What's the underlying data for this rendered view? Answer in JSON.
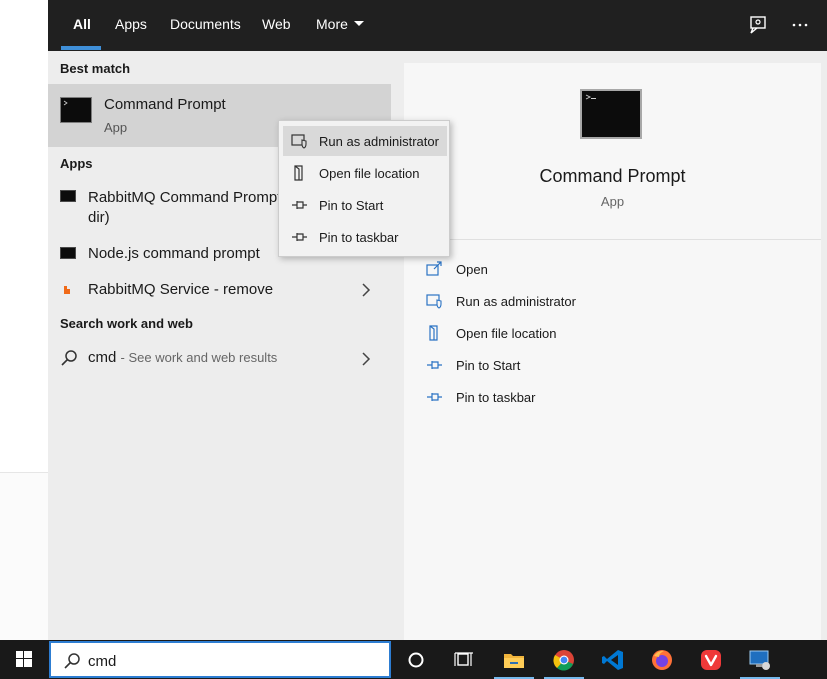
{
  "tabs": [
    {
      "label": "All"
    },
    {
      "label": "Apps"
    },
    {
      "label": "Documents"
    },
    {
      "label": "Web"
    },
    {
      "label": "More"
    }
  ],
  "left": {
    "best_match_heading": "Best match",
    "best_match": {
      "title": "Command Prompt",
      "subtitle": "App"
    },
    "apps_heading": "Apps",
    "apps": [
      {
        "line1": "RabbitMQ Command Prompt",
        "line2": "dir)"
      },
      {
        "label": "Node.js command prompt"
      },
      {
        "label": "RabbitMQ Service - remove"
      }
    ],
    "web_heading": "Search work and web",
    "web_query": "cmd",
    "web_hint": "- See work and web results"
  },
  "context_menu": {
    "items": [
      {
        "label": "Run as administrator"
      },
      {
        "label": "Open file location"
      },
      {
        "label": "Pin to Start"
      },
      {
        "label": "Pin to taskbar"
      }
    ]
  },
  "preview": {
    "title": "Command Prompt",
    "subtitle": "App",
    "actions": [
      {
        "label": "Open"
      },
      {
        "label": "Run as administrator"
      },
      {
        "label": "Open file location"
      },
      {
        "label": "Pin to Start"
      },
      {
        "label": "Pin to taskbar"
      }
    ]
  },
  "taskbar": {
    "search_value": "cmd",
    "icons": [
      "windows-start-icon",
      "cortana-icon",
      "task-view-icon",
      "file-explorer-icon",
      "chrome-icon",
      "vscode-icon",
      "firefox-icon",
      "vivaldi-icon",
      "remote-desktop-icon"
    ]
  },
  "colors": {
    "accent": "#3f8fd8",
    "topbar": "#202020",
    "panel": "#ededed",
    "selected_row": "#d3d3d3",
    "taskbar": "#191919"
  }
}
